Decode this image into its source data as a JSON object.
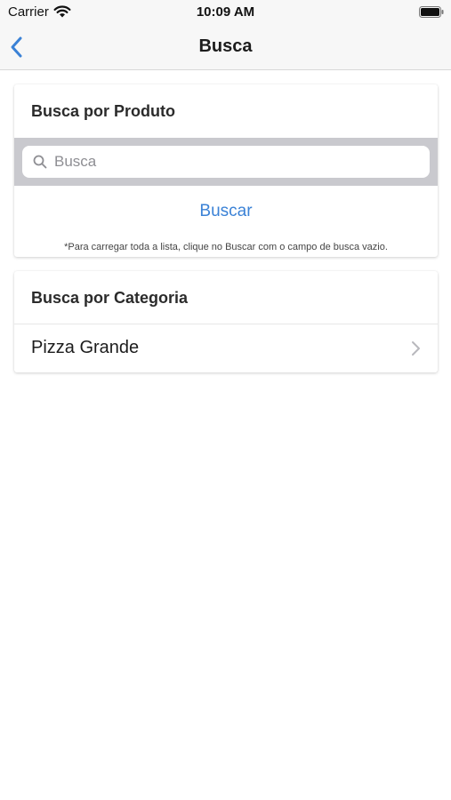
{
  "status_bar": {
    "carrier": "Carrier",
    "time": "10:09 AM",
    "icons": [
      "wifi-icon",
      "battery-icon"
    ]
  },
  "nav": {
    "title": "Busca",
    "back_icon": "chevron-left-icon"
  },
  "produto_section": {
    "title": "Busca por Produto",
    "search": {
      "placeholder": "Busca",
      "value": "",
      "icon": "search-icon"
    },
    "button_label": "Buscar",
    "hint": "*Para carregar toda a lista, clique no Buscar com o campo de busca vazio."
  },
  "categoria_section": {
    "title": "Busca por Categoria",
    "items": [
      {
        "label": "Pizza Grande",
        "icon": "chevron-right-icon"
      }
    ]
  },
  "colors": {
    "accent": "#3b82d6",
    "search_strip": "#c9c9ce",
    "bar_background": "#f7f7f7"
  }
}
